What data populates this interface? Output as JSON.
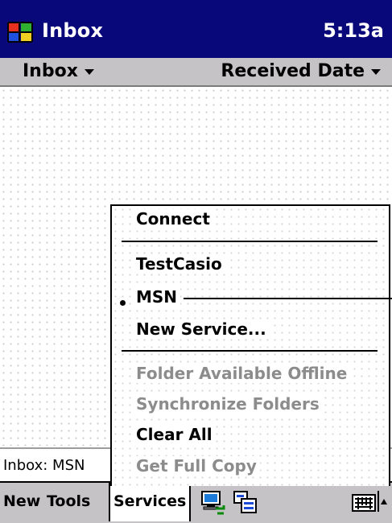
{
  "titlebar": {
    "app_title": "Inbox",
    "clock": "5:13a",
    "logo_icon": "windows-flag-icon"
  },
  "filterbar": {
    "folder": "Inbox",
    "sort": "Received Date"
  },
  "statusbar": {
    "text": "Inbox: MSN"
  },
  "menubar": {
    "items": [
      {
        "label": "New"
      },
      {
        "label": "Tools"
      },
      {
        "label": "Services"
      }
    ],
    "icons": [
      "send-receive-icon",
      "folder-list-icon",
      "keyboard-icon",
      "sip-arrow-icon"
    ]
  },
  "services_menu": {
    "items": [
      {
        "label": "Connect",
        "enabled": true
      },
      {
        "label": "TestCasio",
        "enabled": true
      },
      {
        "label": "MSN",
        "enabled": true,
        "selected": true
      },
      {
        "label": "New Service...",
        "enabled": true
      },
      {
        "label": "Folder Available Offline",
        "enabled": false
      },
      {
        "label": "Synchronize Folders",
        "enabled": false
      },
      {
        "label": "Clear All",
        "enabled": true
      },
      {
        "label": "Get Full Copy",
        "enabled": false
      }
    ]
  },
  "colors": {
    "titlebar": "#08087b",
    "bar_gray": "#c6c3c6",
    "disabled_text": "#8c8c8c"
  }
}
